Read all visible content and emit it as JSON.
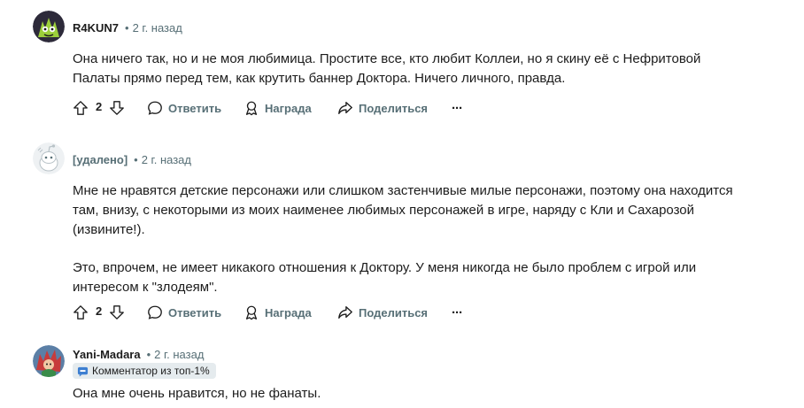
{
  "comments": [
    {
      "author": "R4KUN7",
      "time": "2 г. назад",
      "paragraphs": [
        "Она ничего так, но и не моя любимица. Простите все, кто любит Коллеи, но я скину её с Нефритовой Палаты прямо перед тем, как крутить баннер Доктора. Ничего личного, правда."
      ],
      "votes": "2",
      "reply_label": "Ответить",
      "award_label": "Награда",
      "share_label": "Поделиться",
      "more_label": "···"
    },
    {
      "author": "[удалено]",
      "time": "2 г. назад",
      "paragraphs": [
        "Мне не нравятся детские персонажи или слишком застенчивые милые персонажи, поэтому она находится там, внизу, с некоторыми из моих наименее любимых персонажей в игре, наряду с Кли и Сахарозой (извините!).",
        "Это, впрочем, не имеет никакого отношения к Доктору. У меня никогда не было проблем с игрой или интересом к \"злодеям\"."
      ],
      "votes": "2",
      "reply_label": "Ответить",
      "award_label": "Награда",
      "share_label": "Поделиться",
      "more_label": "···"
    },
    {
      "author": "Yani-Madara",
      "time": "2 г. назад",
      "flair": "Комментатор из топ-1%",
      "paragraphs": [
        "Она мне очень нравится, но не фанаты."
      ]
    }
  ],
  "icons": {
    "upvote": "arrow-up-icon",
    "downvote": "arrow-down-icon",
    "reply": "speech-bubble-icon",
    "award": "award-ribbon-icon",
    "share": "share-arrow-icon",
    "more": "more-dots-icon",
    "flair": "top-commenter-badge-icon"
  },
  "colors": {
    "text": "#1c1c1c",
    "muted": "#576f76",
    "flair_bg": "#e5ebee"
  }
}
